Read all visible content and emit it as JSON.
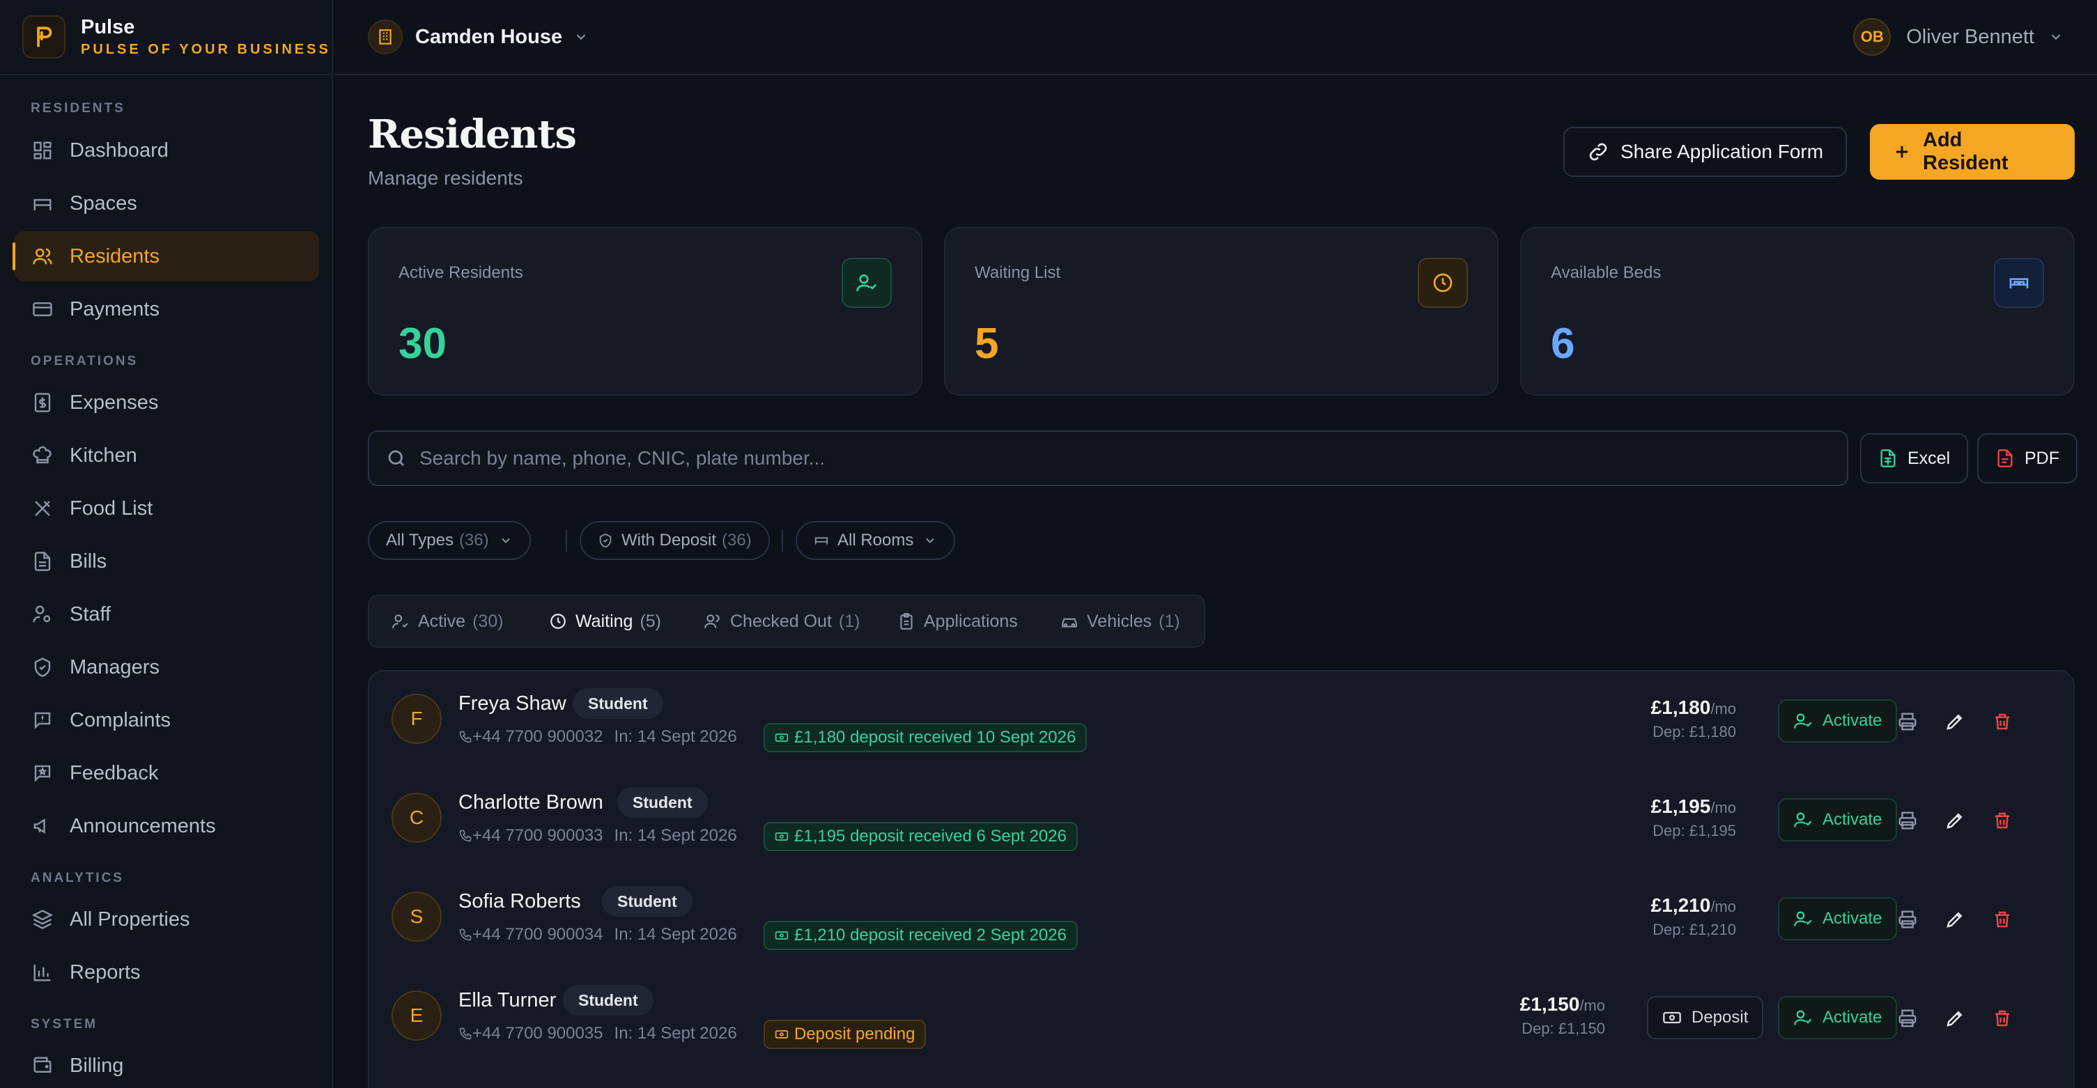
{
  "brand": {
    "name": "Pulse",
    "tagline": "PULSE OF YOUR BUSINESS"
  },
  "sidebar": {
    "sections": {
      "residents": "RESIDENTS",
      "operations": "OPERATIONS",
      "analytics": "ANALYTICS",
      "system": "SYSTEM"
    },
    "items": {
      "dashboard": "Dashboard",
      "spaces": "Spaces",
      "residents": "Residents",
      "payments": "Payments",
      "expenses": "Expenses",
      "kitchen": "Kitchen",
      "food_list": "Food List",
      "bills": "Bills",
      "staff": "Staff",
      "managers": "Managers",
      "complaints": "Complaints",
      "feedback": "Feedback",
      "announcements": "Announcements",
      "all_properties": "All Properties",
      "reports": "Reports",
      "billing": "Billing"
    },
    "active": "residents"
  },
  "topbar": {
    "property": "Camden House",
    "user": {
      "initials": "OB",
      "name": "Oliver Bennett"
    }
  },
  "page": {
    "title": "Residents",
    "subtitle": "Manage residents",
    "share_label": "Share Application Form",
    "add_label": "Add Resident"
  },
  "stats": {
    "active": {
      "label": "Active Residents",
      "value": "30",
      "color": "#34d399"
    },
    "waiting": {
      "label": "Waiting List",
      "value": "5",
      "color": "#f5a623"
    },
    "beds": {
      "label": "Available Beds",
      "value": "6",
      "color": "#6aa8ff"
    }
  },
  "search": {
    "placeholder": "Search by name, phone, CNIC, plate number..."
  },
  "export": {
    "excel": "Excel",
    "pdf": "PDF"
  },
  "filters": {
    "types": {
      "label": "All Types",
      "count": "(36)"
    },
    "deposit": {
      "label": "With Deposit",
      "count": "(36)"
    },
    "rooms": {
      "label": "All Rooms"
    }
  },
  "tabs": {
    "active": {
      "label": "Active",
      "count": "(30)"
    },
    "waiting": {
      "label": "Waiting",
      "count": "(5)"
    },
    "checked_out": {
      "label": "Checked Out",
      "count": "(1)"
    },
    "applications": {
      "label": "Applications"
    },
    "vehicles": {
      "label": "Vehicles",
      "count": "(1)"
    },
    "selected": "waiting"
  },
  "row_labels": {
    "activate": "Activate",
    "deposit": "Deposit",
    "per_month": "/mo"
  },
  "residents": [
    {
      "initial": "F",
      "name": "Freya Shaw",
      "type": "Student",
      "phone": "+44 7700 900032",
      "checkin": "In: 14 Sept 2026",
      "deposit_status": "£1,180 deposit received 10 Sept 2026",
      "deposit_ok": true,
      "rent": "£1,180",
      "dep": "Dep: £1,180"
    },
    {
      "initial": "C",
      "name": "Charlotte Brown",
      "type": "Student",
      "phone": "+44 7700 900033",
      "checkin": "In: 14 Sept 2026",
      "deposit_status": "£1,195 deposit received 6 Sept 2026",
      "deposit_ok": true,
      "rent": "£1,195",
      "dep": "Dep: £1,195"
    },
    {
      "initial": "S",
      "name": "Sofia Roberts",
      "type": "Student",
      "phone": "+44 7700 900034",
      "checkin": "In: 14 Sept 2026",
      "deposit_status": "£1,210 deposit received 2 Sept 2026",
      "deposit_ok": true,
      "rent": "£1,210",
      "dep": "Dep: £1,210"
    },
    {
      "initial": "E",
      "name": "Ella Turner",
      "type": "Student",
      "phone": "+44 7700 900035",
      "checkin": "In: 14 Sept 2026",
      "deposit_status": "Deposit pending",
      "deposit_ok": false,
      "rent": "£1,150",
      "dep": "Dep: £1,150"
    }
  ],
  "colors": {
    "accent": "#f5a623",
    "success": "#34d399",
    "danger": "#ef4444",
    "info": "#6aa8ff"
  }
}
